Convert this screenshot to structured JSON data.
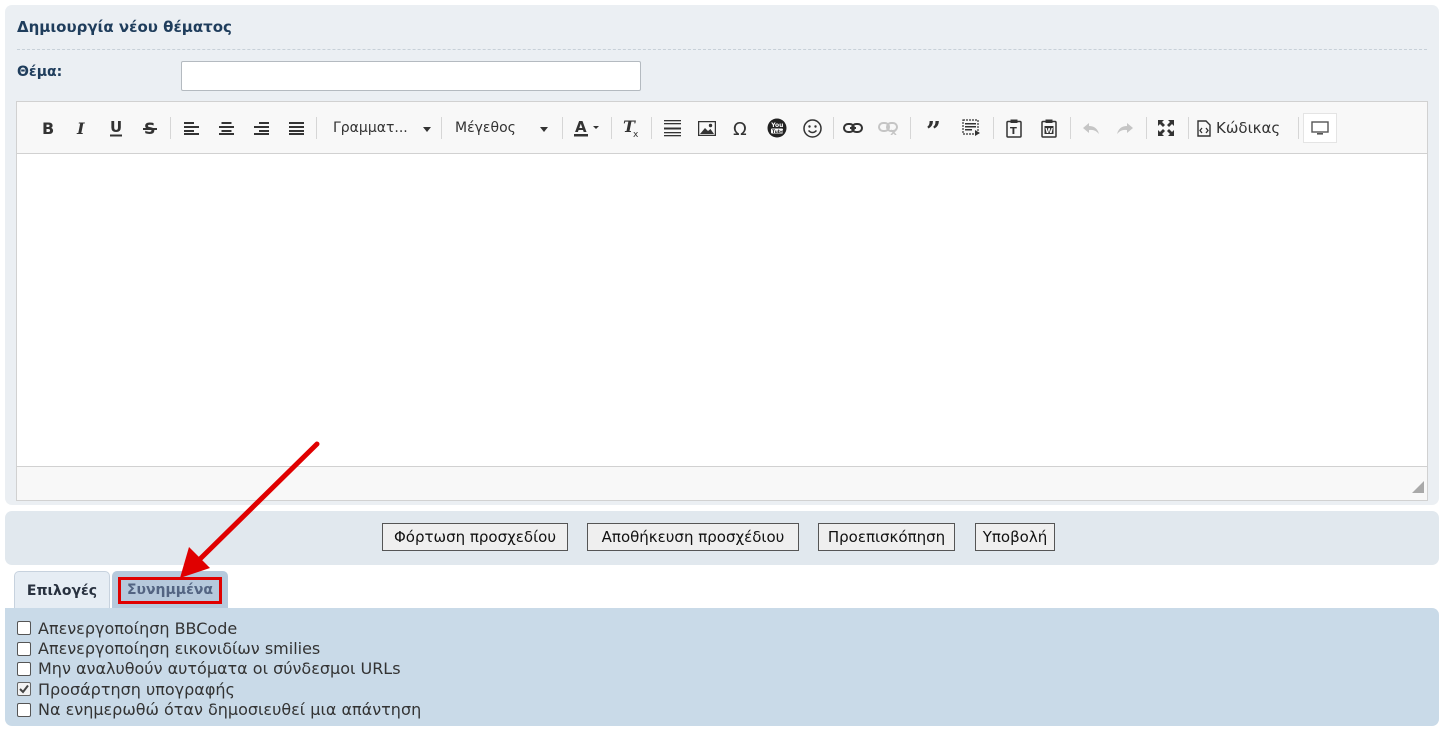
{
  "form": {
    "title": "Δημιουργία νέου θέματος",
    "subject_label": "Θέμα:",
    "subject_value": "",
    "subject_placeholder": ""
  },
  "toolbar": {
    "font_combo": "Γραμματ...",
    "size_combo": "Μέγεθος",
    "source_label": "Κώδικας",
    "buttons": [
      "bold-icon",
      "italic-icon",
      "underline-icon",
      "strikethrough-icon",
      "align-left-icon",
      "align-center-icon",
      "align-right-icon",
      "justify-icon",
      "text-color-icon",
      "remove-format-icon",
      "horizontal-rule-icon",
      "image-icon",
      "omega-icon",
      "youtube-icon",
      "smiley-icon",
      "link-icon",
      "unlink-icon",
      "quote-icon",
      "code-block-icon",
      "paste-text-icon",
      "paste-word-icon",
      "undo-icon",
      "redo-icon",
      "maximize-icon",
      "source-icon",
      "preview-icon"
    ]
  },
  "actions": {
    "load_draft": "Φόρτωση προσχεδίου",
    "save_draft": "Αποθήκευση προσχέδιου",
    "preview": "Προεπισκόπηση",
    "submit": "Υποβολή"
  },
  "tabs": {
    "options": "Επιλογές",
    "attachments": "Συνημμένα"
  },
  "options": [
    {
      "label": "Απενεργοποίηση BBCode",
      "checked": false
    },
    {
      "label": "Απενεργοποίηση εικονιδίων smilies",
      "checked": false
    },
    {
      "label": "Μην αναλυθούν αυτόματα οι σύνδεσμοι URLs",
      "checked": false
    },
    {
      "label": "Προσάρτηση υπογραφής",
      "checked": true
    },
    {
      "label": "Να ενημερωθώ όταν δημοσιευθεί μια απάντηση",
      "checked": false
    }
  ],
  "colors": {
    "title": "#1f3d5c",
    "panel_bg": "#ebeff3",
    "options_bg": "#c9dae8",
    "highlight": "#e00000"
  }
}
